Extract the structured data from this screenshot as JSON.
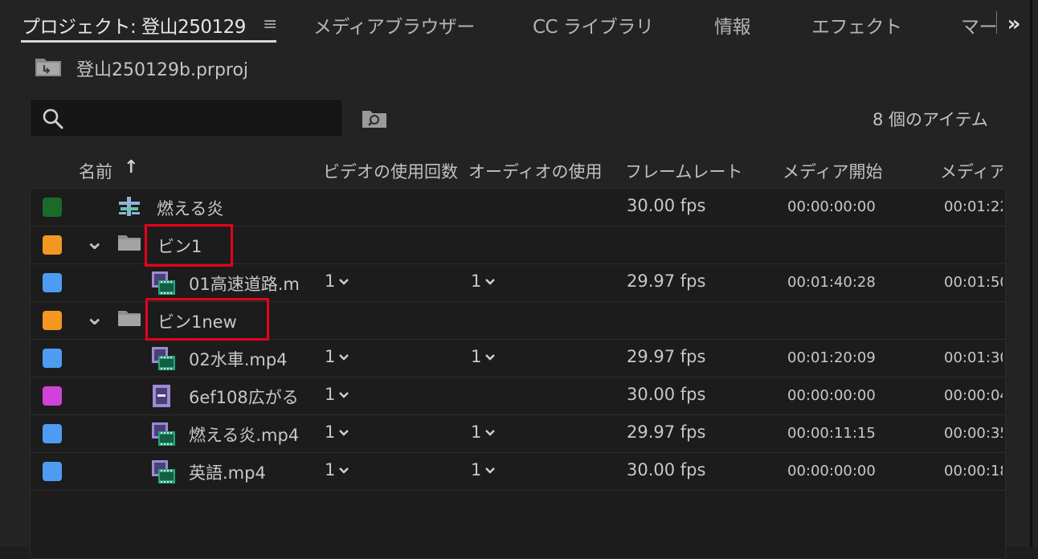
{
  "tabs": [
    {
      "label": "プロジェクト: 登山250129",
      "active": true
    },
    {
      "label": "メディアブラウザー"
    },
    {
      "label": "CC ライブラリ"
    },
    {
      "label": "情報"
    },
    {
      "label": "エフェクト"
    },
    {
      "label": "マー"
    }
  ],
  "tab_menu_icon": "≡",
  "tab_overflow_icon": "»",
  "project_file": "登山250129b.prproj",
  "search": {
    "value": "",
    "placeholder": ""
  },
  "item_count": "8 個のアイテム",
  "columns": {
    "name": "名前",
    "video_usage": "ビデオの使用回数",
    "audio_usage": "オーディオの使用",
    "frame_rate": "フレームレート",
    "media_start": "メディア開始",
    "media_end": "メディア"
  },
  "colors": {
    "green": "#1a6b2a",
    "orange": "#f39720",
    "blue": "#4d9cf2",
    "magenta": "#d042d8",
    "highlight": "#e8001c"
  },
  "rows": [
    {
      "swatch": "green",
      "icon": "sequence-icon",
      "name": "燃える炎",
      "video": "",
      "audio": "",
      "fps": "30.00 fps",
      "start": "00:00:00:00",
      "end": "00:01:22",
      "indent": 1
    },
    {
      "swatch": "orange",
      "icon": "folder-icon",
      "name": "ビン1",
      "video": "",
      "audio": "",
      "fps": "",
      "start": "",
      "end": "",
      "indent": 0,
      "bin": true
    },
    {
      "swatch": "blue",
      "icon": "video-clip-icon",
      "name": "01高速道路.m",
      "video": "1",
      "audio": "1",
      "fps": "29.97 fps",
      "start": "00:01:40:28",
      "end": "00:01:50",
      "indent": 2
    },
    {
      "swatch": "orange",
      "icon": "folder-icon",
      "name": "ビン1new",
      "video": "",
      "audio": "",
      "fps": "",
      "start": "",
      "end": "",
      "indent": 0,
      "bin": true
    },
    {
      "swatch": "blue",
      "icon": "video-clip-icon",
      "name": "02水車.mp4",
      "video": "1",
      "audio": "1",
      "fps": "29.97 fps",
      "start": "00:01:20:09",
      "end": "00:01:30",
      "indent": 2
    },
    {
      "swatch": "magenta",
      "icon": "still-clip-icon",
      "name": "6ef108広がる",
      "video": "1",
      "audio": "",
      "fps": "30.00 fps",
      "start": "00:00:00:00",
      "end": "00:00:04",
      "indent": 2
    },
    {
      "swatch": "blue",
      "icon": "video-clip-icon",
      "name": "燃える炎.mp4",
      "video": "1",
      "audio": "1",
      "fps": "29.97 fps",
      "start": "00:00:11:15",
      "end": "00:00:35",
      "indent": 2
    },
    {
      "swatch": "blue",
      "icon": "video-clip-icon",
      "name": "英語.mp4",
      "video": "1",
      "audio": "1",
      "fps": "30.00 fps",
      "start": "00:00:00:00",
      "end": "00:00:18",
      "indent": 2
    }
  ]
}
